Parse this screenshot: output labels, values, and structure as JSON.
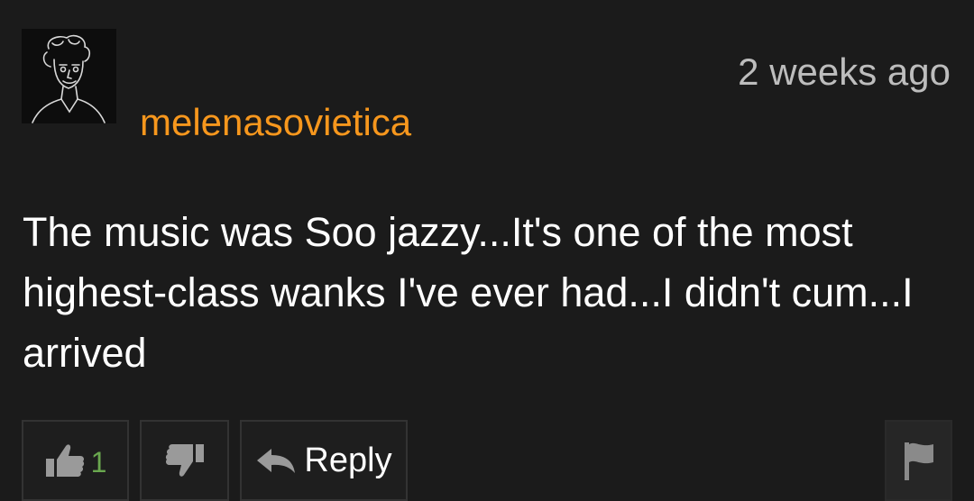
{
  "comment": {
    "username": "melenasovietica",
    "timestamp": "2 weeks ago",
    "body": "The music was Soo jazzy...It's one of the most highest-class wanks I've ever had...I didn't cum...I arrived"
  },
  "actions": {
    "like_count": "1",
    "reply_label": "Reply"
  },
  "colors": {
    "background": "#1b1b1b",
    "username": "#f7971d",
    "timestamp": "#bdbdbd",
    "like_count": "#6aa84f"
  },
  "icons": [
    "avatar-sketch",
    "thumbs-up-icon",
    "thumbs-down-icon",
    "reply-arrow-icon",
    "flag-icon"
  ]
}
